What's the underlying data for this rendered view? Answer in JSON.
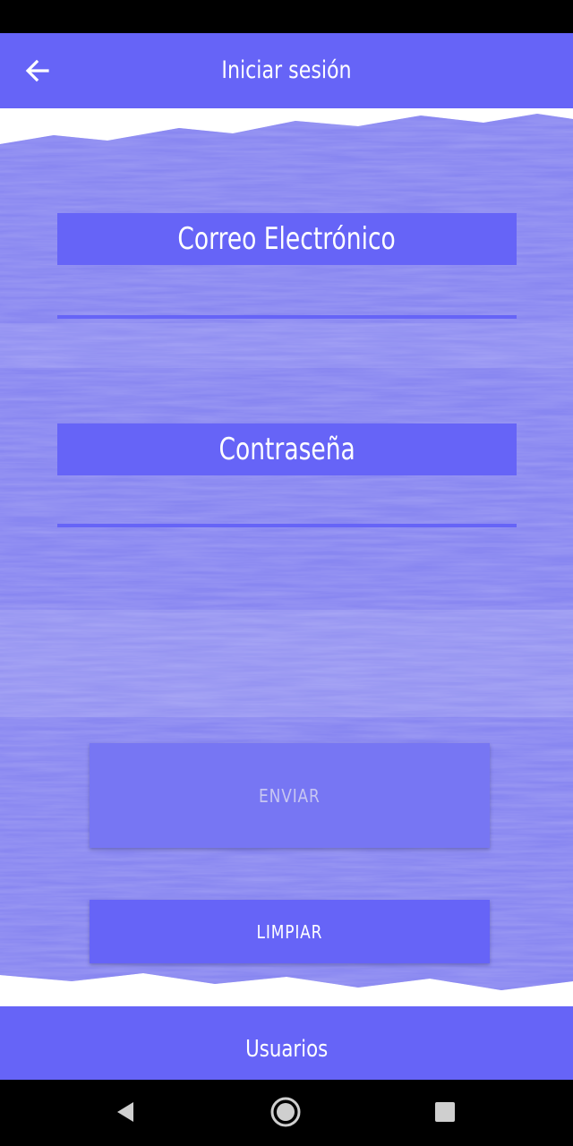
{
  "app_bar": {
    "title": "Iniciar sesión",
    "back_icon": "arrow-left-icon"
  },
  "form": {
    "email": {
      "label": "Correo Electrónico",
      "value": "",
      "placeholder": ""
    },
    "password": {
      "label": "Contraseña",
      "value": "",
      "placeholder": ""
    },
    "submit_label": "ENVIAR",
    "submit_enabled": false,
    "clear_label": "LIMPIAR"
  },
  "bottom_bar": {
    "label": "Usuarios"
  },
  "system_nav": {
    "back_icon": "triangle-back-icon",
    "home_icon": "circle-home-icon",
    "recents_icon": "square-recents-icon"
  },
  "colors": {
    "primary": "#6664f7",
    "background_paint": "#8b89f1",
    "button_disabled": "#7776f3",
    "text_on_primary": "#ffffff"
  }
}
